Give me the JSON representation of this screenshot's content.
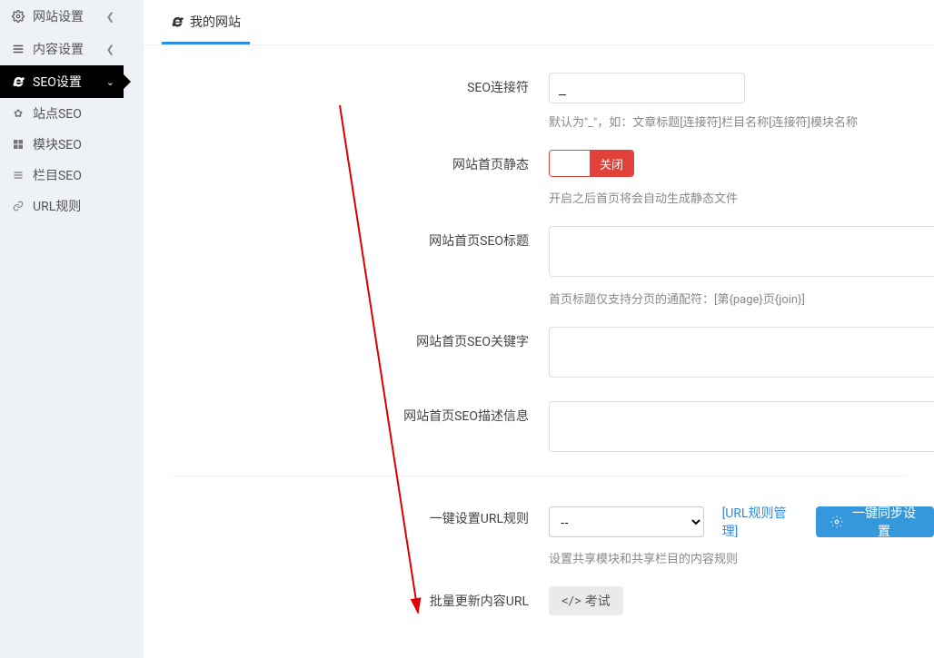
{
  "sidebar": {
    "items": [
      {
        "icon": "gear",
        "label": "网站设置",
        "chev": "left"
      },
      {
        "icon": "list",
        "label": "内容设置",
        "chev": "left"
      },
      {
        "icon": "ie",
        "label": "SEO设置",
        "chev": "down",
        "active": true
      }
    ],
    "sub_items": [
      {
        "icon": "gear",
        "label": "站点SEO"
      },
      {
        "icon": "grid",
        "label": "模块SEO"
      },
      {
        "icon": "bars",
        "label": "栏目SEO"
      },
      {
        "icon": "link",
        "label": "URL规则"
      }
    ]
  },
  "tab": {
    "label": "我的网站"
  },
  "form": {
    "seo_connector": {
      "label": "SEO连接符",
      "value": "_",
      "hint": "默认为\"_\"，如：文章标题[连接符]栏目名称[连接符]模块名称"
    },
    "home_static": {
      "label": "网站首页静态",
      "value_off": "关闭",
      "hint": "开启之后首页将会自动生成静态文件"
    },
    "home_seo_title": {
      "label": "网站首页SEO标题",
      "hint": "首页标题仅支持分页的通配符：[第{page}页{join}]"
    },
    "home_seo_keywords": {
      "label": "网站首页SEO关键字"
    },
    "home_seo_desc": {
      "label": "网站首页SEO描述信息"
    },
    "url_rule": {
      "label": "一键设置URL规则",
      "select_value": "--",
      "link": "[URL规则管理]",
      "button": "一键同步设置",
      "hint": "设置共享模块和共享栏目的内容规则"
    },
    "batch_update": {
      "label": "批量更新内容URL",
      "button": "考试"
    }
  }
}
